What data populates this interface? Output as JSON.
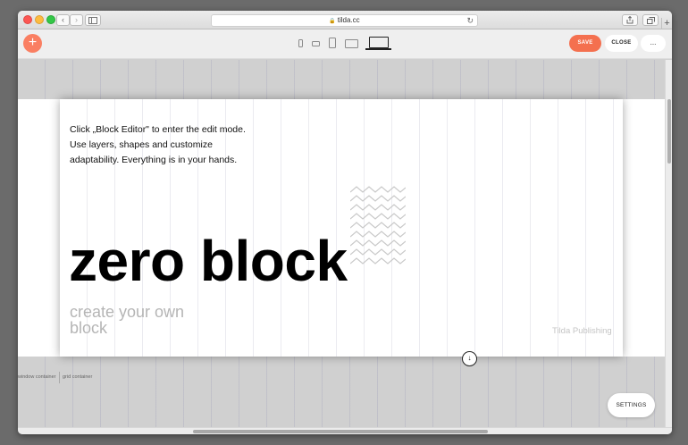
{
  "browser": {
    "url": "tilda.cc",
    "back_glyph": "‹",
    "forward_glyph": "›",
    "new_tab_glyph": "+",
    "lock_glyph": "🔒",
    "reload_glyph": "↻"
  },
  "toolbar": {
    "add_glyph": "+",
    "save_label": "SAVE",
    "close_label": "CLOSE",
    "more_label": "...",
    "accent_color": "#f4704f",
    "devices": [
      "phone-portrait",
      "phone-landscape",
      "tablet-portrait",
      "tablet-landscape",
      "desktop"
    ],
    "active_device": "desktop"
  },
  "block": {
    "intro_lines": [
      "Click „Block Editor\" to enter the edit mode.",
      "Use layers, shapes and customize",
      "adaptability. Everything is in your hands."
    ],
    "title": "zero block",
    "subtitle_lines": [
      "create your own",
      "block"
    ],
    "publisher": "Tilda Publishing"
  },
  "workspace": {
    "handle_glyph": "↓",
    "window_container_label": "window container",
    "grid_container_label": "grid container",
    "settings_label": "SETTINGS"
  }
}
